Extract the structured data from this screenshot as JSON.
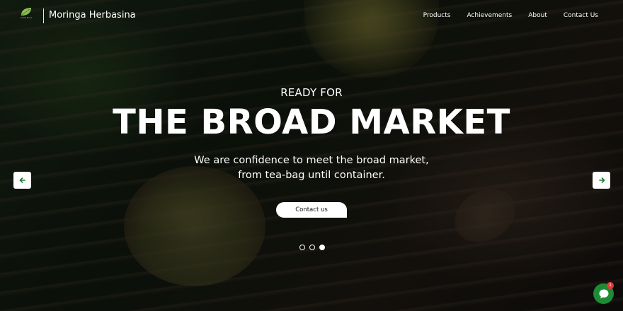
{
  "header": {
    "logo_text": "Saraf Food",
    "site_name": "Moringa Herbasina",
    "nav": [
      "Products",
      "Achievements",
      "About",
      "Contact Us"
    ]
  },
  "hero": {
    "kicker": "READY FOR",
    "headline": "THE BROAD MARKET",
    "subtext_line1": "We are confidence to meet the broad market,",
    "subtext_line2": "from tea-bag until container.",
    "cta_label": "Contact us",
    "slides_total": 3,
    "active_slide": 3
  },
  "controls": {
    "prev_icon": "arrow-left-icon",
    "next_icon": "arrow-right-icon"
  },
  "chat": {
    "icon": "chat-bubble-icon",
    "badge_count": "1"
  },
  "colors": {
    "accent_green": "#1e7a2e",
    "chat_green": "#1f8a35",
    "badge_red": "#e53935"
  }
}
